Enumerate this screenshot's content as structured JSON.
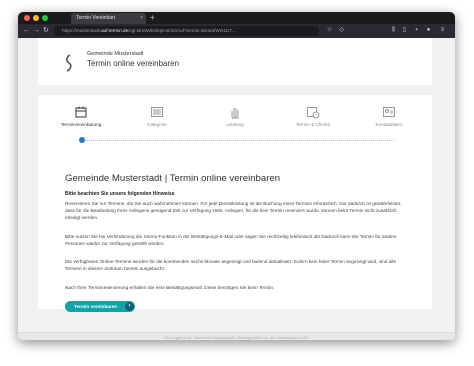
{
  "browser": {
    "tab_title": "Termin Vereinbart",
    "tab_close": "×",
    "new_tab": "+",
    "url_prefix": "https://musterstadt.",
    "url_domain": "auf-termin.de",
    "url_rest": "/cgi-bin/WebObjects/SOAuf?termin-wizard/WO11/7..."
  },
  "header": {
    "municipality": "Gemeinde Musterstadt",
    "app_title": "Termin online vereinbaren"
  },
  "steps": [
    {
      "label": "Terminvereinbarung",
      "icon": "calendar-icon",
      "active": true
    },
    {
      "label": "Kategorie",
      "icon": "list-icon",
      "active": false
    },
    {
      "label": "Leistung",
      "icon": "hand-icon",
      "active": false
    },
    {
      "label": "Termin & Uhrzeit",
      "icon": "clock-calendar-icon",
      "active": false
    },
    {
      "label": "Kontaktdaten",
      "icon": "contact-icon",
      "active": false
    }
  ],
  "content": {
    "heading": "Gemeinde Musterstadt | Termin online vereinbaren",
    "notice_title": "Bitte beachten Sie unsere folgenden Hinweise",
    "paragraphs": [
      "Reservieren Sie nur Termine, die Sie auch wahrnehmen können. Für jede Dienstleistung ist die Buchung eines Termins erforderlich. Nur dadurch ist gewährleistet, dass für die Bearbeitung Ihres Anliegens genügend Zeit zur Verfügung steht. Anliegen, für die kein Termin reserviert wurde, können beim Termin nicht zusätzlich erledigt werden.",
      "Bitte nutzen Sie bei Verhinderung die Storno-Funktion in der Bestätigungs-E-Mail oder sagen Sie rechtzeitig telefonisch ab! Dadurch kann der Termin für andere Personen wieder zur Verfügung gestellt werden.",
      "Die verfügbaren Online-Termine werden für die kommenden sechs Monate angezeigt und laufend aktualisiert. Sofern kein freier Termin angezeigt wird, sind alle Termine in diesem Zeitraum bereits ausgebucht.",
      "Nach Ihrer Terminreservierung erhalten Sie eine Bestätigungsmail. Diese benötigen Sie beim Termin."
    ],
    "button_label": "Termin vereinbaren",
    "button_arrow": "›"
  },
  "footer": {
    "text": "Ein Angebot der Gemeinde Musterstadt | Bereitgestellt von der Softwarekonor AG"
  },
  "colors": {
    "accent": "#13a3a6",
    "step_active": "#1a7fc1"
  }
}
